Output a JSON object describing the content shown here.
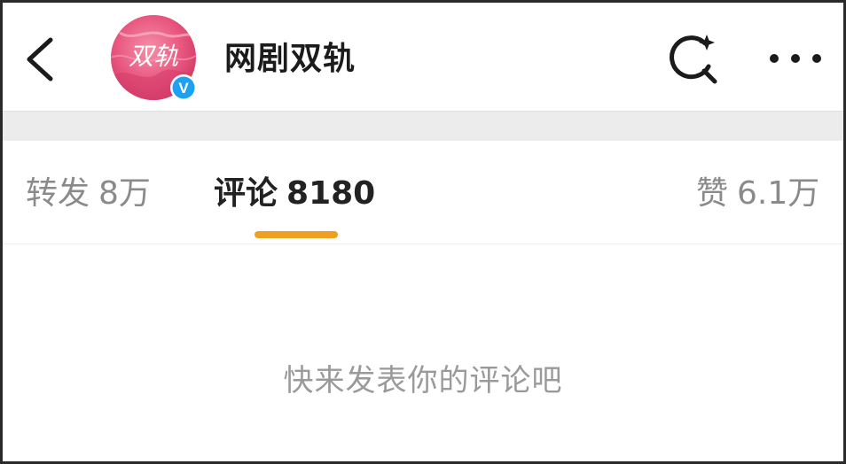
{
  "header": {
    "account_name": "网剧双轨",
    "avatar_text": "双轨",
    "verified_mark": "V"
  },
  "tabs": [
    {
      "label": "转发",
      "count": "8万",
      "active": false
    },
    {
      "label": "评论",
      "count": "8180",
      "active": true
    },
    {
      "label": "赞",
      "count": "6.1万",
      "active": false
    }
  ],
  "empty_state": {
    "text": "快来发表你的评论吧"
  },
  "colors": {
    "active_indicator": "#f0a020",
    "verified_badge": "#1da1f2",
    "avatar_pink": "#e8577f",
    "divider_band": "#ececec"
  },
  "icons": {
    "back": "chevron-left-icon",
    "search": "search-sparkle-icon",
    "more": "more-dots-icon",
    "verified": "verified-badge-icon"
  }
}
